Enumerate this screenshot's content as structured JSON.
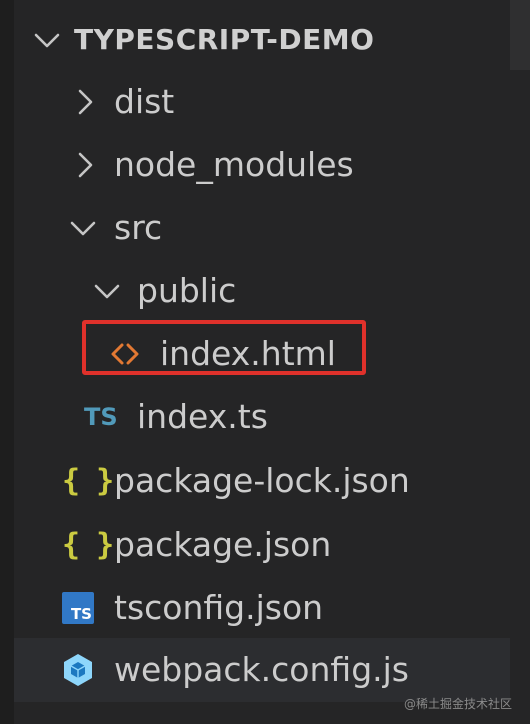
{
  "explorer": {
    "root": {
      "label": "TYPESCRIPT-DEMO",
      "expanded": true
    },
    "items": [
      {
        "label": "dist",
        "type": "folder",
        "expanded": false
      },
      {
        "label": "node_modules",
        "type": "folder",
        "expanded": false
      },
      {
        "label": "src",
        "type": "folder",
        "expanded": true
      },
      {
        "label": "public",
        "type": "folder",
        "expanded": true
      },
      {
        "label": "index.html",
        "type": "file",
        "icon": "html-file-icon",
        "highlighted": true
      },
      {
        "label": "index.ts",
        "type": "file",
        "icon": "typescript-file-icon",
        "icon_text": "TS"
      },
      {
        "label": "package-lock.json",
        "type": "file",
        "icon": "json-braces-icon",
        "icon_text": "{ }"
      },
      {
        "label": "package.json",
        "type": "file",
        "icon": "json-braces-icon",
        "icon_text": "{ }"
      },
      {
        "label": "tsconfig.json",
        "type": "file",
        "icon": "tsconfig-file-icon",
        "icon_text": "TS"
      },
      {
        "label": "webpack.config.js",
        "type": "file",
        "icon": "webpack-file-icon",
        "hovered": true
      }
    ]
  },
  "watermark": "@稀土掘金技术社区",
  "colors": {
    "background": "#252526",
    "text": "#cccccc",
    "highlight_border": "#e0312b",
    "json_icon": "#cbcb41",
    "ts_icon": "#519aba",
    "html_icon": "#e37933",
    "webpack_icon": "#8ed6fb"
  }
}
